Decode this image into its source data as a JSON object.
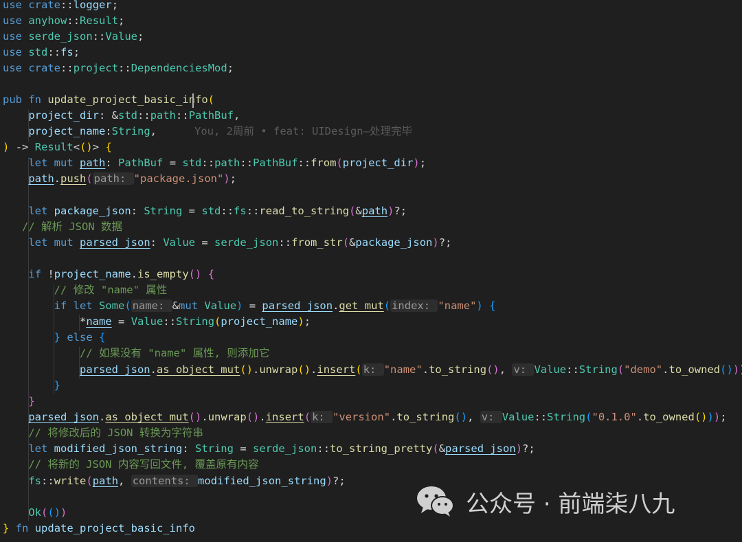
{
  "code_lines": [
    "use crate::logger;",
    "use anyhow::Result;",
    "use serde_json::Value;",
    "use std::fs;",
    "use crate::project::DependenciesMod;",
    "",
    "pub fn update_project_basic_info(",
    "    project_dir: &std::path::PathBuf,",
    "    project_name:String,",
    ") -> Result<()> {",
    "    let mut path: PathBuf = std::path::PathBuf::from(project_dir);",
    "    path.push(path: \"package.json\");",
    "",
    "    let package_json: String = std::fs::read_to_string(&path)?;",
    "   // 解析 JSON 数据",
    "    let mut parsed_json: Value = serde_json::from_str(&package_json)?;",
    "",
    "    if !project_name.is_empty() {",
    "        // 修改 \"name\" 属性",
    "        if let Some(name: &mut Value) = parsed_json.get_mut(index: \"name\") {",
    "            *name = Value::String(project_name);",
    "        } else {",
    "            // 如果没有 \"name\" 属性, 则添加它",
    "            parsed_json.as_object_mut().unwrap().insert(k: \"name\".to_string(), v: Value::String(\"demo\".to_owned()));",
    "        }",
    "    }",
    "    parsed_json.as_object_mut().unwrap().insert(k: \"version\".to_string(), v: Value::String(\"0.1.0\".to_owned()));",
    "    // 将修改后的 JSON 转换为字符串",
    "    let modified_json_string: String = serde_json::to_string_pretty(&parsed_json)?;",
    "    // 将新的 JSON 内容写回文件, 覆盖原有内容",
    "    fs::write(path, contents: modified_json_string)?;",
    "",
    "    Ok(())",
    "} fn update_project_basic_info"
  ],
  "blame": "You, 2周前 • feat: UIDesign—处理完毕",
  "watermark": {
    "label": "公众号 · 前端柒八九",
    "icon": "wechat-icon"
  },
  "colors": {
    "background": "#1f1f1f",
    "keyword": "#569cd6",
    "function": "#dcdcaa",
    "type": "#4ec9b0",
    "variable": "#9cdcfe",
    "string": "#ce9178",
    "comment": "#6a9955"
  }
}
